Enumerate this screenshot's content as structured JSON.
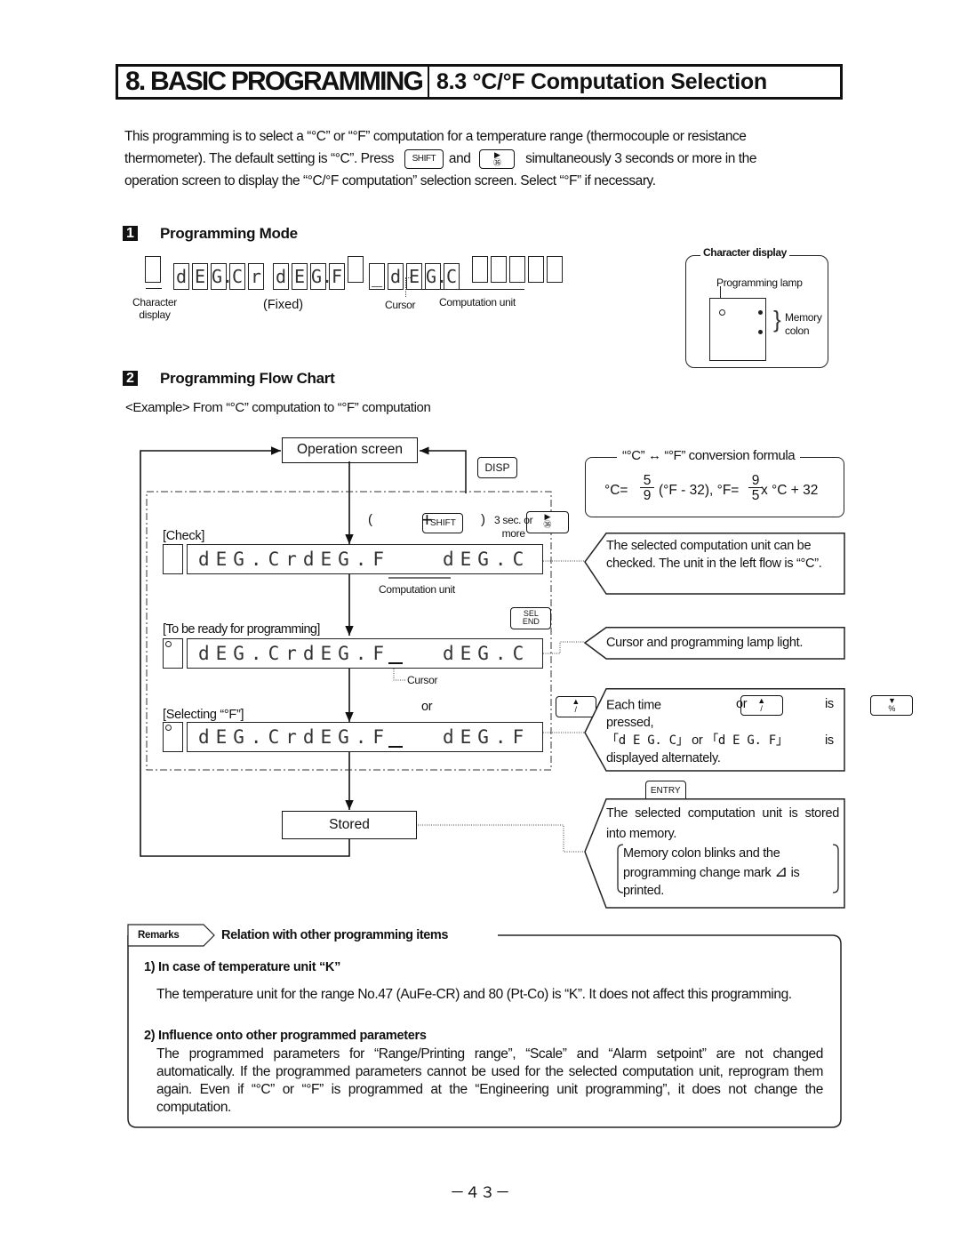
{
  "header": {
    "chapter": "8. BASIC PROGRAMMING",
    "section": "8.3 °C/°F Computation Selection"
  },
  "intro": {
    "line1": "This programming is to select a “°C” or “°F” computation for a temperature range (thermocouple or resistance",
    "line2_pre": "thermometer). The default setting is “°C”. Press",
    "and": "and",
    "line2_post": "simultaneously 3 seconds or more in the",
    "line3": "operation screen to display the “°C/°F computation” selection screen. Select “°F” if necessary."
  },
  "keys": {
    "shift": "SHIFT",
    "shift_alt": "SHIFT",
    "right": "▶",
    "right_sub": "㊱",
    "disp": "DISP",
    "sel_top": "SEL",
    "sel_bottom": "END",
    "up": "▲",
    "up_sub": "/",
    "down": "▼",
    "down_sub": "%",
    "entry": "ENTRY"
  },
  "section1": {
    "num": "1",
    "title": "Programming Mode",
    "display_segments": [
      "",
      "d",
      "E",
      "G.",
      "C",
      "r",
      "d",
      "E",
      "G.",
      "F",
      "",
      "_",
      "d",
      "E",
      "G.",
      "C",
      "",
      "",
      "",
      "",
      ""
    ],
    "labels": {
      "char_display": "Character display",
      "fixed": "(Fixed)",
      "cursor": "Cursor",
      "computation_unit": "Computation unit"
    },
    "char_panel": {
      "title": "Character display",
      "programming_lamp": "Programming lamp",
      "memory_colon_1": "Memory",
      "memory_colon_2": "colon"
    }
  },
  "section2": {
    "num": "2",
    "title": "Programming Flow Chart",
    "example": "<Example> From “°C” computation to “°F” computation",
    "operation_screen": "Operation screen",
    "stored": "Stored",
    "key_hint_open": "(",
    "key_hint_plus": "+",
    "key_hint_close": ")",
    "key_hint_time_1": "3 sec. or",
    "key_hint_time_2": "more",
    "or": "or",
    "steps": [
      {
        "label": "[Check]",
        "display": "dEG.CrdEG.F   dEG.C",
        "sub": "Computation unit",
        "lamp": false
      },
      {
        "label": "[To be ready for programming]",
        "display": "dEG.CrdEG.F   dEG.C",
        "sub": "Cursor",
        "lamp": true
      },
      {
        "label": "[Selecting “°F”]",
        "display": "dEG.CrdEG.F   dEG.F",
        "sub": "",
        "lamp": true
      }
    ],
    "formula": {
      "title": "“°C” ↔ “°F” conversion formula",
      "c_eq": "°C=",
      "c_num": "5",
      "c_den": "9",
      "c_rest": "(°F - 32), °F=",
      "f_num": "9",
      "f_den": "5",
      "f_rest": "x °C + 32"
    },
    "notes": {
      "check": "The selected computation unit can be checked. The unit in the left flow is “°C”.",
      "ready": "Cursor and programming lamp light.",
      "select_1": "Each time",
      "select_or": "or",
      "select_is": "is",
      "select_2": "pressed,",
      "select_3a": "「d E G. C」",
      "select_3or": "or",
      "select_3b": "「d E G. F」",
      "select_3is": "is",
      "select_4": "displayed alternately.",
      "stored_1": "The selected computation unit is stored into memory.",
      "stored_2": "Memory colon blinks and the programming change mark",
      "stored_mark": "⊿",
      "stored_3": "is",
      "stored_4": "printed."
    }
  },
  "remarks": {
    "tag": "Remarks",
    "title": "Relation with other programming items",
    "items": [
      {
        "heading": "1) In case of temperature unit “K”",
        "body": "The temperature unit for the range No.47 (AuFe-CR) and 80 (Pt-Co) is “K”. It does not affect this programming."
      },
      {
        "heading": "2) Influence onto other programmed parameters",
        "body": "The programmed parameters for “Range/Printing range”, “Scale” and “Alarm setpoint” are not changed automatically. If the programmed parameters cannot be used for the selected computation unit, reprogram them again. Even if “°C” or “°F” is programmed at the “Engineering unit programming”, it does not change the computation."
      }
    ]
  },
  "page_number": "－４３－"
}
